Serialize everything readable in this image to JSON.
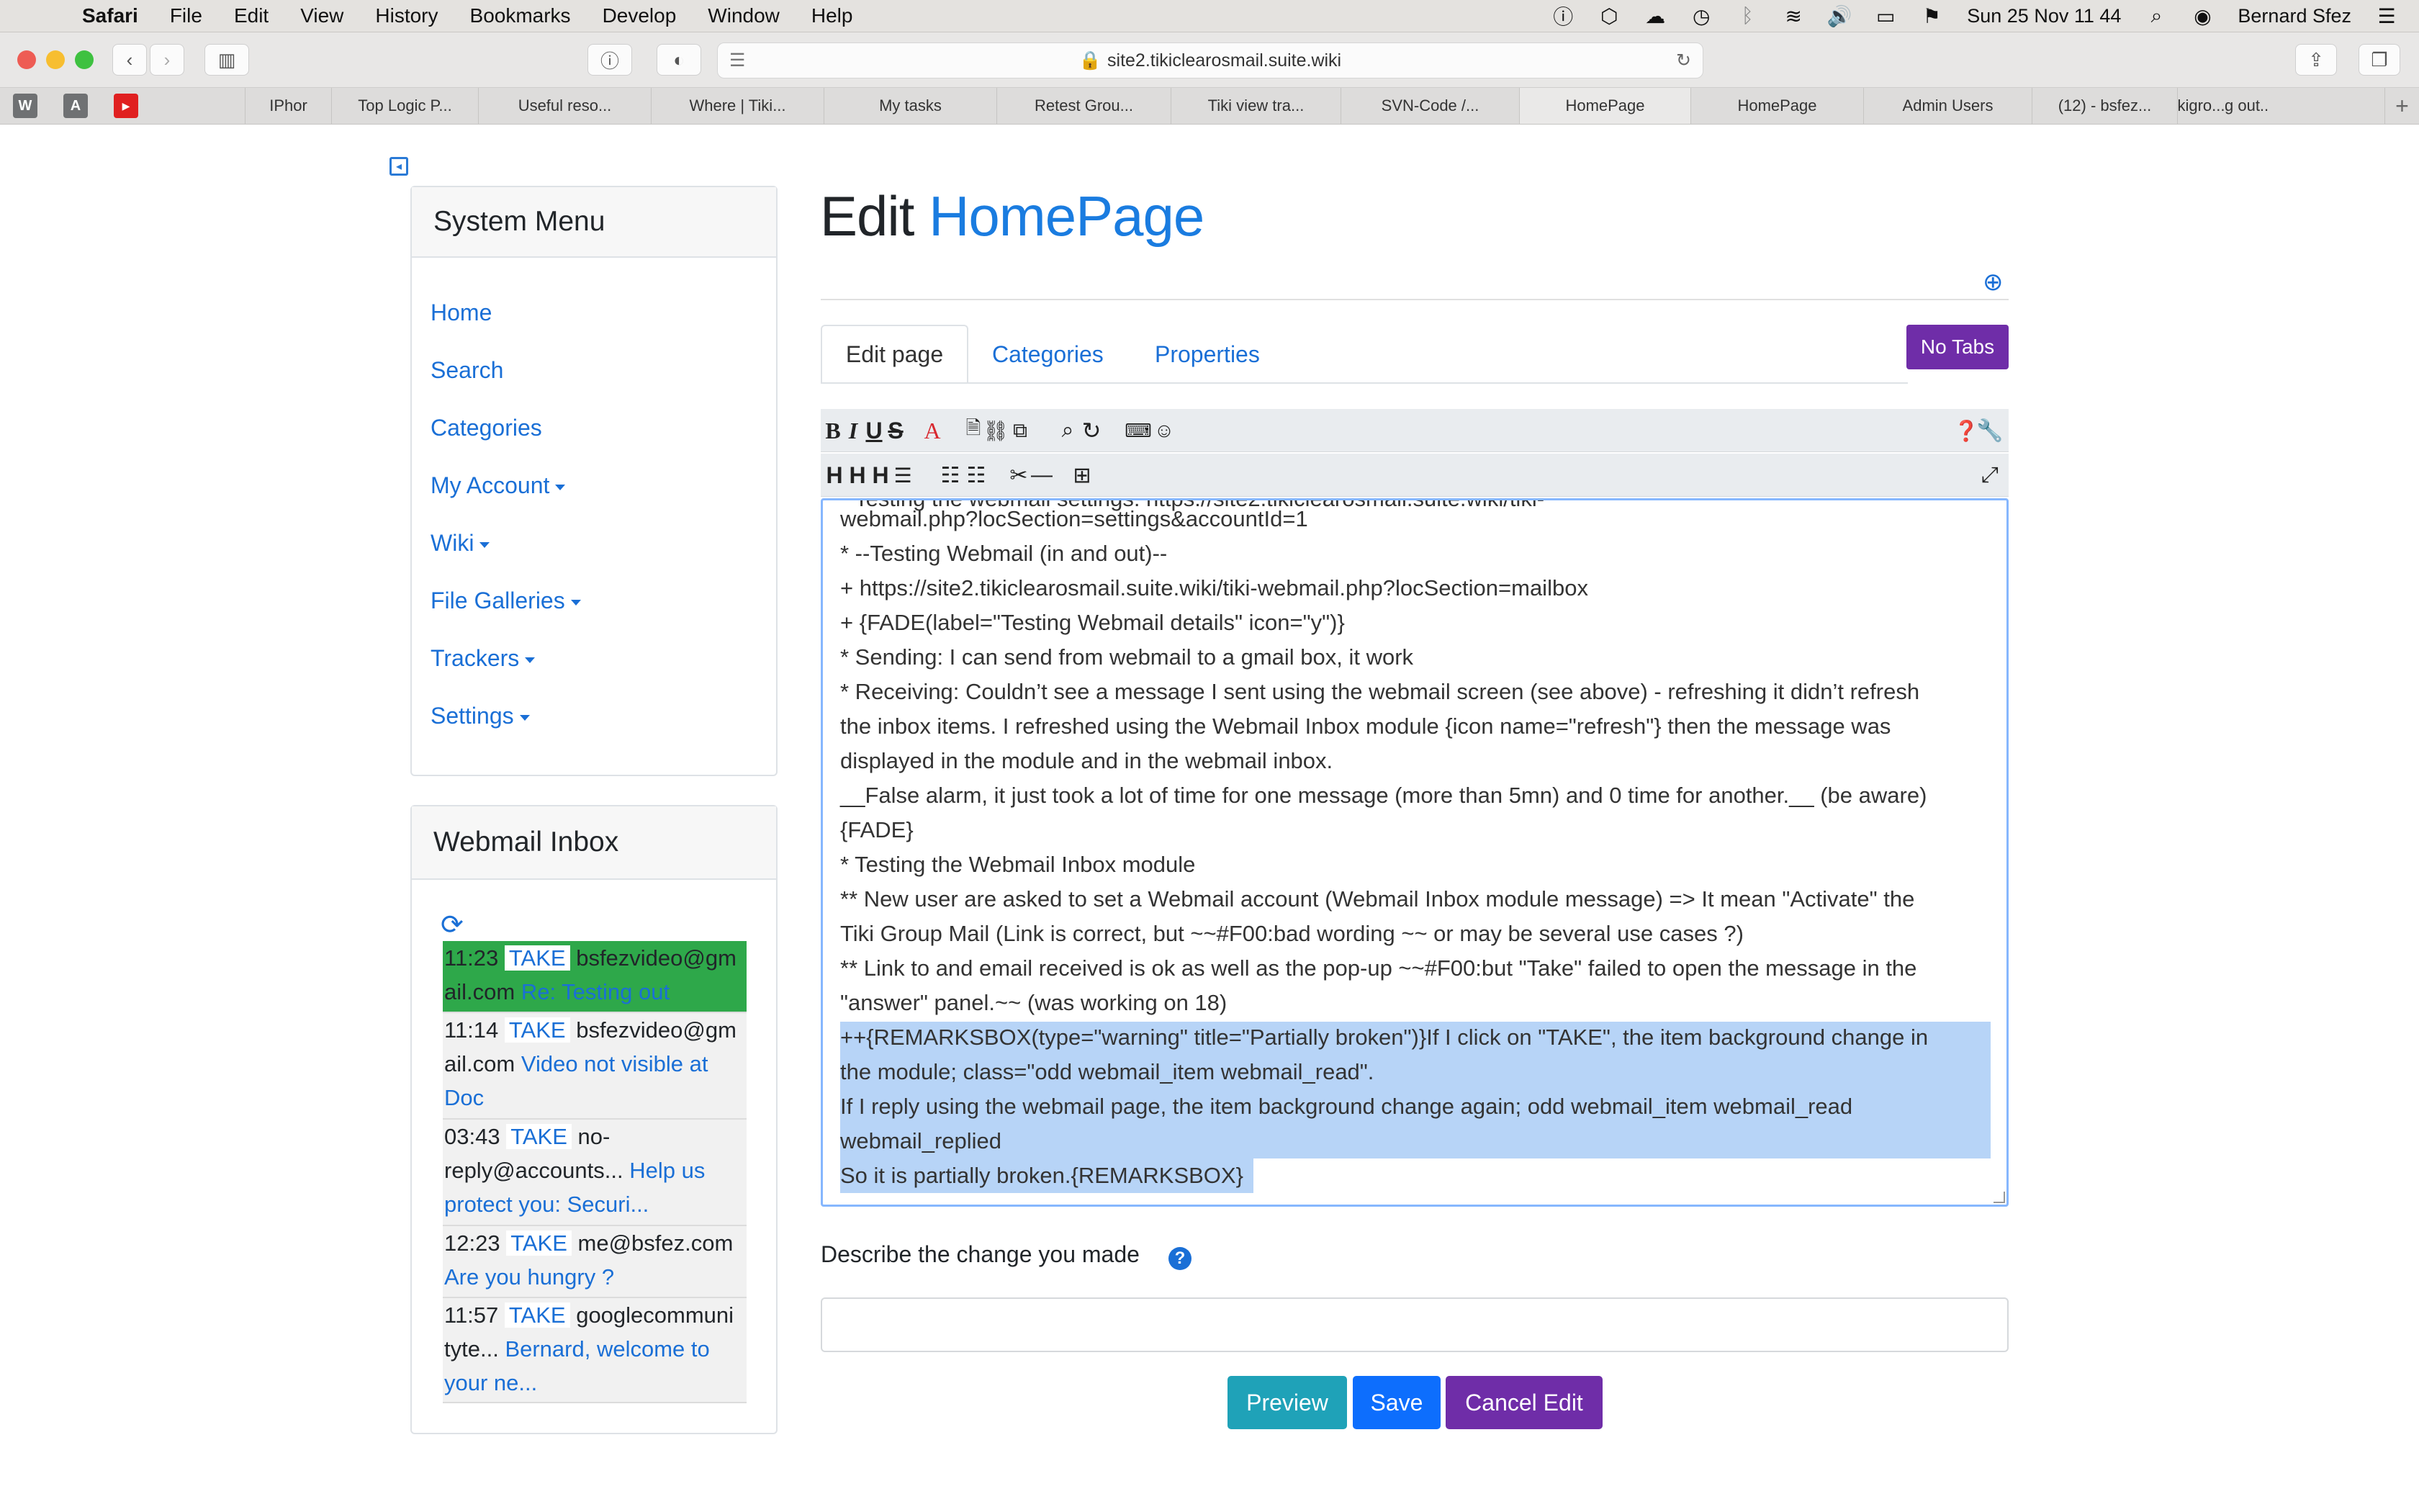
{
  "menubar": {
    "app": "Safari",
    "items": [
      "File",
      "Edit",
      "View",
      "History",
      "Bookmarks",
      "Develop",
      "Window",
      "Help"
    ],
    "datetime": "Sun 25 Nov  11 44",
    "user": "Bernard Sfez"
  },
  "browser": {
    "url": "site2.tikiclearosmail.suite.wiki",
    "pinned": [
      "W",
      "A",
      "▶"
    ],
    "tabs": [
      "IPhor",
      "Top Logic P...",
      "Useful reso...",
      "Where | Tiki...",
      "My tasks",
      "Retest Grou...",
      "Tiki view tra...",
      "SVN-Code /...",
      "HomePage",
      "HomePage",
      "Admin Users",
      "(12) - bsfez...",
      "kigro...",
      "g out..."
    ],
    "active_tab_index": 8
  },
  "system_menu": {
    "title": "System Menu",
    "items": [
      {
        "label": "Home",
        "dropdown": false
      },
      {
        "label": "Search",
        "dropdown": false
      },
      {
        "label": "Categories",
        "dropdown": false
      },
      {
        "label": "My Account",
        "dropdown": true
      },
      {
        "label": "Wiki",
        "dropdown": true
      },
      {
        "label": "File Galleries",
        "dropdown": true
      },
      {
        "label": "Trackers",
        "dropdown": true
      },
      {
        "label": "Settings",
        "dropdown": true
      }
    ]
  },
  "webmail": {
    "title": "Webmail Inbox",
    "take_label": "TAKE",
    "messages": [
      {
        "time": "11:23",
        "from_1": "bsfezvideo@gm",
        "from_2": "ail.com",
        "subject": "Re: Testing out",
        "highlight": true
      },
      {
        "time": "11:14",
        "from_1": "bsfezvideo@gm",
        "from_2": "ail.com",
        "subject": "Video not visible at",
        "subject_2": "Doc"
      },
      {
        "time": "03:43",
        "from_1": "no-",
        "from_2": "reply@accounts...",
        "subject": "Help us",
        "subject_2": "protect you: Securi..."
      },
      {
        "time": "12:23",
        "from_1": "me@bsfez.com",
        "subject": "Are you hungry ?"
      },
      {
        "time": "11:57",
        "from_1": "googlecommuni",
        "from_2": "tyte...",
        "subject": "Bernard, welcome to",
        "subject_2": "your ne..."
      }
    ]
  },
  "page": {
    "title_prefix": "Edit",
    "title_page": "HomePage",
    "tabs": [
      "Edit page",
      "Categories",
      "Properties"
    ],
    "no_tabs_label": "No Tabs"
  },
  "editor": {
    "toolbar_row1": [
      "B",
      "I",
      "U",
      "S",
      "A"
    ],
    "toolbar_row2": [
      "H",
      "H",
      "H"
    ],
    "lines": [
      "webmail.php?locSection=settings&accountId=1",
      "* --Testing Webmail (in and out)--",
      "+ https://site2.tikiclearosmail.suite.wiki/tiki-webmail.php?locSection=mailbox",
      "+ {FADE(label=\"Testing Webmail details\" icon=\"y\")}",
      "* Sending: I can send from webmail to a gmail box, it work",
      "* Receiving: Couldn’t see a message I sent using the webmail screen (see above) - refreshing it didn’t refresh",
      "the inbox items. I refreshed using the Webmail Inbox module {icon name=\"refresh\"} then the message was",
      "displayed in the module and in the webmail inbox.",
      " __False alarm, it just took a lot of time for one message (more than 5mn) and 0 time for another.__ (be aware)",
      "{FADE}",
      "* Testing the Webmail Inbox module",
      "** New user are asked to set a Webmail account (Webmail Inbox module message) => It mean \"Activate\" the",
      "Tiki Group Mail (Link is correct, but ~~#F00:bad wording ~~ or may be several use cases ?)",
      "** Link to and email received is ok as well as the pop-up ~~#F00:but \"Take\" failed to open the message in the",
      "\"answer\" panel.~~ (was working on 18)",
      "++{REMARKSBOX(type=\"warning\" title=\"Partially broken\")}If I click on \"TAKE\", the item background change in",
      "the module; class=\"odd webmail_item webmail_read\".",
      "If I reply using the webmail page, the item background change again; odd webmail_item webmail_read",
      "webmail_replied",
      "So it is partially broken.{REMARKSBOX}"
    ]
  },
  "form": {
    "describe_label": "Describe the change you made",
    "describe_value": "",
    "buttons": {
      "preview": "Preview",
      "save": "Save",
      "cancel": "Cancel Edit"
    }
  },
  "colors": {
    "link": "#1a6fd6",
    "purple": "#6f2da8",
    "teal": "#1fa2b8",
    "blue": "#0d6efd",
    "mail_highlight": "#2ea84a",
    "selection": "#b7d4f7"
  }
}
